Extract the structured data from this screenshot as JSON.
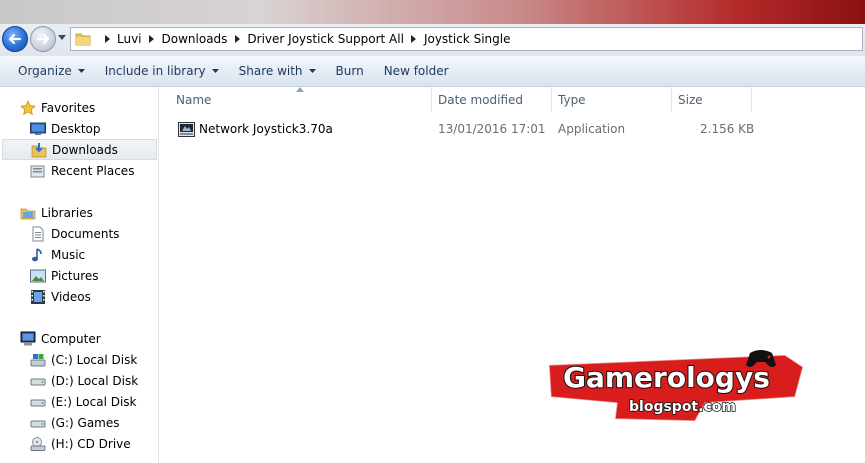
{
  "nav": {
    "back_icon": "back-arrow-icon",
    "forward_icon": "forward-arrow-icon"
  },
  "address": {
    "crumbs": [
      "Luvi",
      "Downloads",
      "Driver Joystick Support All",
      "Joystick Single"
    ]
  },
  "toolbar": {
    "organize": "Organize",
    "include_in_library": "Include in library",
    "share_with": "Share with",
    "burn": "Burn",
    "new_folder": "New folder"
  },
  "sidebar": {
    "favorites": "Favorites",
    "desktop": "Desktop",
    "downloads": "Downloads",
    "recent_places": "Recent Places",
    "libraries": "Libraries",
    "documents": "Documents",
    "music": "Music",
    "pictures": "Pictures",
    "videos": "Videos",
    "computer": "Computer",
    "drive_c": "(C:) Local Disk",
    "drive_d": "(D:) Local Disk",
    "drive_e": "(E:) Local Disk",
    "drive_g": "(G:) Games",
    "drive_h": "(H:) CD Drive"
  },
  "columns": {
    "name": "Name",
    "date_modified": "Date modified",
    "type": "Type",
    "size": "Size"
  },
  "files": [
    {
      "name": "Network Joystick3.70a",
      "date_modified": "13/01/2016 17:01",
      "type": "Application",
      "size": "2.156 KB"
    }
  ],
  "watermark": {
    "brand": "Gamerologys",
    "domain": "blogspot.com"
  },
  "colors": {
    "toolbar_text": "#1e395b",
    "column_header_text": "#4c607a",
    "selected_bg": "#e6eaef"
  }
}
